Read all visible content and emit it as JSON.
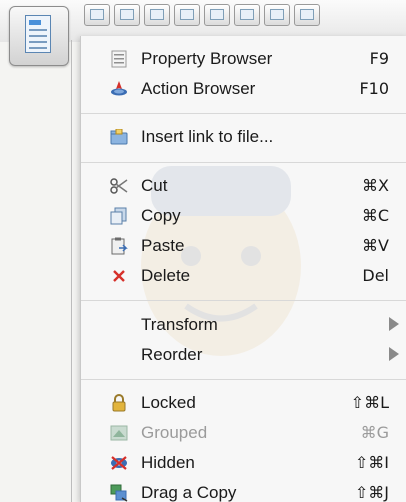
{
  "menu": {
    "items": [
      {
        "label": "Property Browser",
        "shortcut": "F9",
        "icon": "property-sheet-icon"
      },
      {
        "label": "Action Browser",
        "shortcut": "F10",
        "icon": "action-icon"
      },
      {
        "label": "Insert link to file...",
        "shortcut": "",
        "icon": "folder-link-icon"
      },
      {
        "label": "Cut",
        "shortcut": "⌘X",
        "icon": "scissors-icon"
      },
      {
        "label": "Copy",
        "shortcut": "⌘C",
        "icon": "copy-icon"
      },
      {
        "label": "Paste",
        "shortcut": "⌘V",
        "icon": "paste-icon"
      },
      {
        "label": "Delete",
        "shortcut": "Del",
        "icon": "delete-x-icon"
      },
      {
        "label": "Transform",
        "submenu": true
      },
      {
        "label": "Reorder",
        "submenu": true
      },
      {
        "label": "Locked",
        "shortcut": "⇧⌘L",
        "icon": "padlock-icon"
      },
      {
        "label": "Grouped",
        "shortcut": "⌘G",
        "icon": "group-icon",
        "disabled": true
      },
      {
        "label": "Hidden",
        "shortcut": "⇧⌘I",
        "icon": "hidden-eye-icon"
      },
      {
        "label": "Drag a Copy",
        "shortcut": "⇧⌘J",
        "icon": "drag-copy-icon"
      }
    ]
  },
  "colors": {
    "menu_bg": "#f7f7f7",
    "separator": "#d8d8d8",
    "delete_red": "#d6302a",
    "disabled_text": "#9b9b9b",
    "accent_blue": "#4a90d9"
  }
}
